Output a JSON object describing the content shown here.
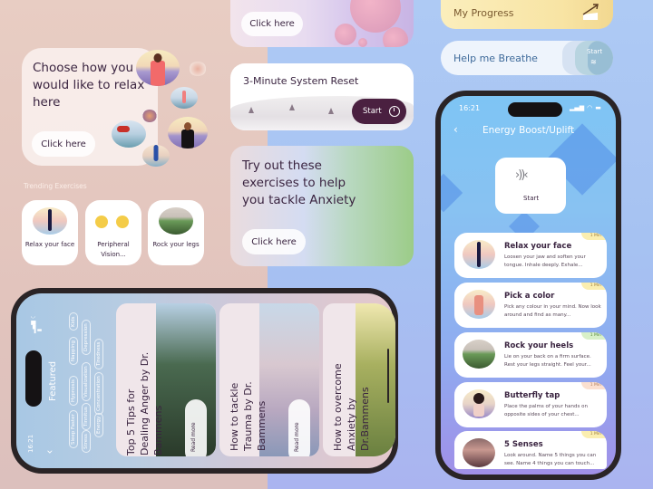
{
  "choose_card": {
    "title": "Choose how you would like to relax here",
    "button_label": "Click here"
  },
  "trending": {
    "heading": "Trending Exercises",
    "tiles": [
      {
        "label": "Relax your face"
      },
      {
        "label": "Peripheral Vision..."
      },
      {
        "label": "Rock your legs"
      }
    ]
  },
  "top_card": {
    "button_label": "Click here"
  },
  "reset_card": {
    "title": "3-Minute System Reset",
    "start_label": "Start"
  },
  "anxiety_card": {
    "title": "Try out these exercises to help you tackle Anxiety",
    "button_label": "Click here"
  },
  "progress_button": {
    "label": "My Progress"
  },
  "breathe_button": {
    "label": "Help me Breathe",
    "start_label": "Start"
  },
  "phone_right": {
    "status_time": "16:21",
    "title": "Energy Boost/Uplift",
    "start_tile_label": "Start",
    "exercises": [
      {
        "title": "Relax your face",
        "desc": "Loosen your jaw and soften your tongue. Inhale deeply. Exhale...",
        "badge": "1 Min",
        "badge_color": "#fbeeb0"
      },
      {
        "title": "Pick a color",
        "desc": "Pick any colour in your mind. Now look around and find as many...",
        "badge": "1 Min",
        "badge_color": "#fbeeb0"
      },
      {
        "title": "Rock your heels",
        "desc": "Lie on your back on a firm surface. Rest your legs straight. Feel your...",
        "badge": "1 Min",
        "badge_color": "#d8f0c8"
      },
      {
        "title": "Butterfly tap",
        "desc": "Place the palms of your hands on opposite sides of your chest...",
        "badge": "1 Min",
        "badge_color": "#fbe0d0"
      },
      {
        "title": "5 Senses",
        "desc": "Look around. Name 5 things you can see. Name 4 things you can touch...",
        "badge": "1 Min",
        "badge_color": "#fbeeb0"
      }
    ]
  },
  "phone_left": {
    "status_time": "16:21",
    "title": "Featured",
    "tags": [
      "Sleep Faster",
      "Hypnosis",
      "Napping",
      "Kids",
      "Stress",
      "Tinnitus",
      "Visualization",
      "Depression",
      "Energy",
      "Concentration",
      "Tiredness"
    ],
    "articles": [
      {
        "title_lines": [
          "Top 5 Tips for",
          "Dealing Anger by Dr.",
          "Bammens"
        ],
        "read_more": "Read more"
      },
      {
        "title_lines": [
          "How to tackle",
          "Trauma by Dr.",
          "Bammens"
        ],
        "read_more": "Read more"
      },
      {
        "title_lines": [
          "How to overcome",
          "Anxiety by",
          "Dr.Bammens"
        ],
        "read_more": ""
      }
    ]
  },
  "colors": {
    "primary_dark": "#4a2040",
    "text": "#3a2440",
    "progress_yellow": "#f8e4a4",
    "breathe_blue": "#3e6a9a"
  }
}
